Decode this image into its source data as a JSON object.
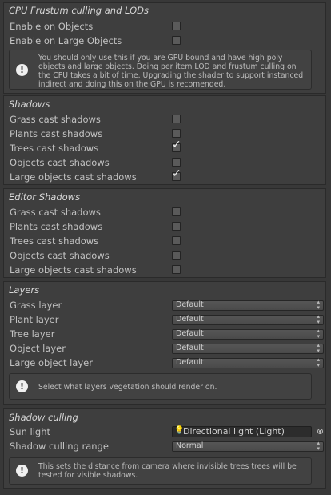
{
  "sections": {
    "frustum": {
      "title": "CPU Frustum culling and LODs",
      "rows": [
        {
          "label": "Enable on Objects",
          "checked": false
        },
        {
          "label": "Enable on Large Objects",
          "checked": false
        }
      ],
      "info": "You should only use this if you are GPU bound and have high poly objects and large objects. Doing per item LOD and frustum culling on the CPU takes a bit of time. Upgrading the shader to support instanced indirect and doing this on the GPU is recomended."
    },
    "shadows": {
      "title": "Shadows",
      "rows": [
        {
          "label": "Grass cast shadows",
          "checked": false
        },
        {
          "label": "Plants cast shadows",
          "checked": false
        },
        {
          "label": "Trees cast shadows",
          "checked": true
        },
        {
          "label": "Objects cast shadows",
          "checked": false
        },
        {
          "label": "Large objects cast shadows",
          "checked": true
        }
      ]
    },
    "editor_shadows": {
      "title": "Editor Shadows",
      "rows": [
        {
          "label": "Grass cast shadows",
          "checked": false
        },
        {
          "label": "Plants cast shadows",
          "checked": false
        },
        {
          "label": "Trees cast shadows",
          "checked": false
        },
        {
          "label": "Objects cast shadows",
          "checked": false
        },
        {
          "label": "Large objects cast shadows",
          "checked": false
        }
      ]
    },
    "layers": {
      "title": "Layers",
      "rows": [
        {
          "label": "Grass layer",
          "value": "Default"
        },
        {
          "label": "Plant layer",
          "value": "Default"
        },
        {
          "label": "Tree layer",
          "value": "Default"
        },
        {
          "label": "Object layer",
          "value": "Default"
        },
        {
          "label": "Large object layer",
          "value": "Default"
        }
      ],
      "info": "Select what layers vegetation should render on."
    },
    "shadow_culling": {
      "title": "Shadow culling",
      "sun_light_label": "Sun light",
      "sun_light_value": "Directional light (Light)",
      "range_label": "Shadow culling range",
      "range_value": "Normal",
      "info": "This sets the distance from camera where invisible trees trees will be tested for visible shadows."
    }
  },
  "icons": {
    "info": "info-icon",
    "checkmark": "checkmark-icon",
    "dropdown": "dropdown-arrows-icon",
    "light": "lightbulb-icon",
    "picker": "object-picker-icon"
  }
}
